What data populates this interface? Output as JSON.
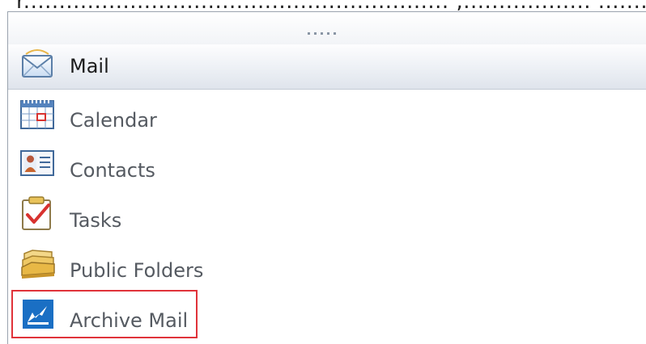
{
  "top_fragment": "r............................................................ ,.................. ..............................p",
  "nav_pane": {
    "items": [
      {
        "label": "Mail",
        "icon": "mail-envelope-icon",
        "selected": true
      },
      {
        "label": "Calendar",
        "icon": "calendar-icon",
        "selected": false
      },
      {
        "label": "Contacts",
        "icon": "contacts-card-icon",
        "selected": false
      },
      {
        "label": "Tasks",
        "icon": "tasks-checklist-icon",
        "selected": false
      },
      {
        "label": "Public Folders",
        "icon": "public-folders-icon",
        "selected": false
      },
      {
        "label": "Archive Mail",
        "icon": "archive-mail-icon",
        "selected": false
      }
    ]
  },
  "colors": {
    "highlight_box": "#e0333a",
    "selected_band": "#dfe4ec",
    "archive_blue": "#1a6fc4"
  }
}
